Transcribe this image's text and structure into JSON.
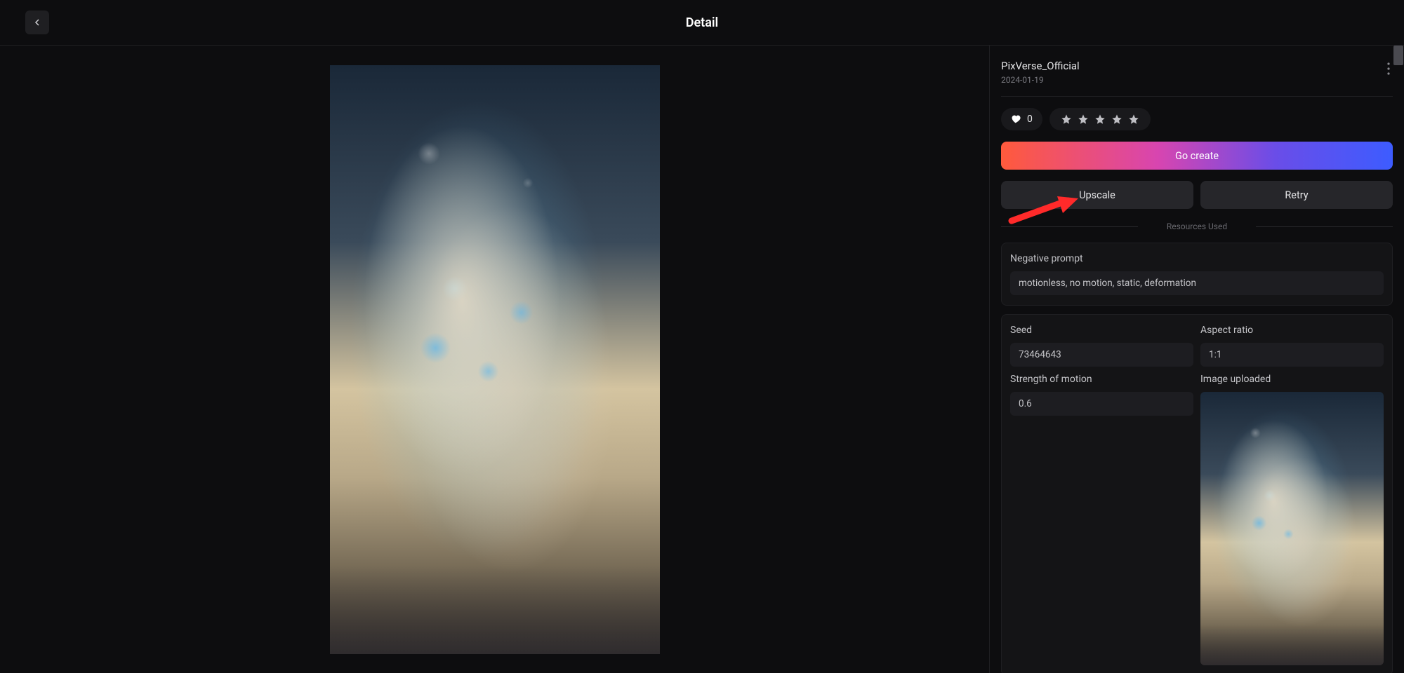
{
  "header": {
    "title": "Detail"
  },
  "user": {
    "name": "PixVerse_Official",
    "date": "2024-01-19"
  },
  "likes": 0,
  "buttons": {
    "go_create": "Go create",
    "upscale": "Upscale",
    "retry": "Retry"
  },
  "divider": "Resources Used",
  "negative_prompt": {
    "label": "Negative prompt",
    "value": "motionless, no motion, static, deformation"
  },
  "params": {
    "seed": {
      "label": "Seed",
      "value": "73464643"
    },
    "aspect_ratio": {
      "label": "Aspect ratio",
      "value": "1:1"
    },
    "strength_of_motion": {
      "label": "Strength of motion",
      "value": "0.6"
    },
    "image_uploaded": {
      "label": "Image uploaded"
    }
  }
}
